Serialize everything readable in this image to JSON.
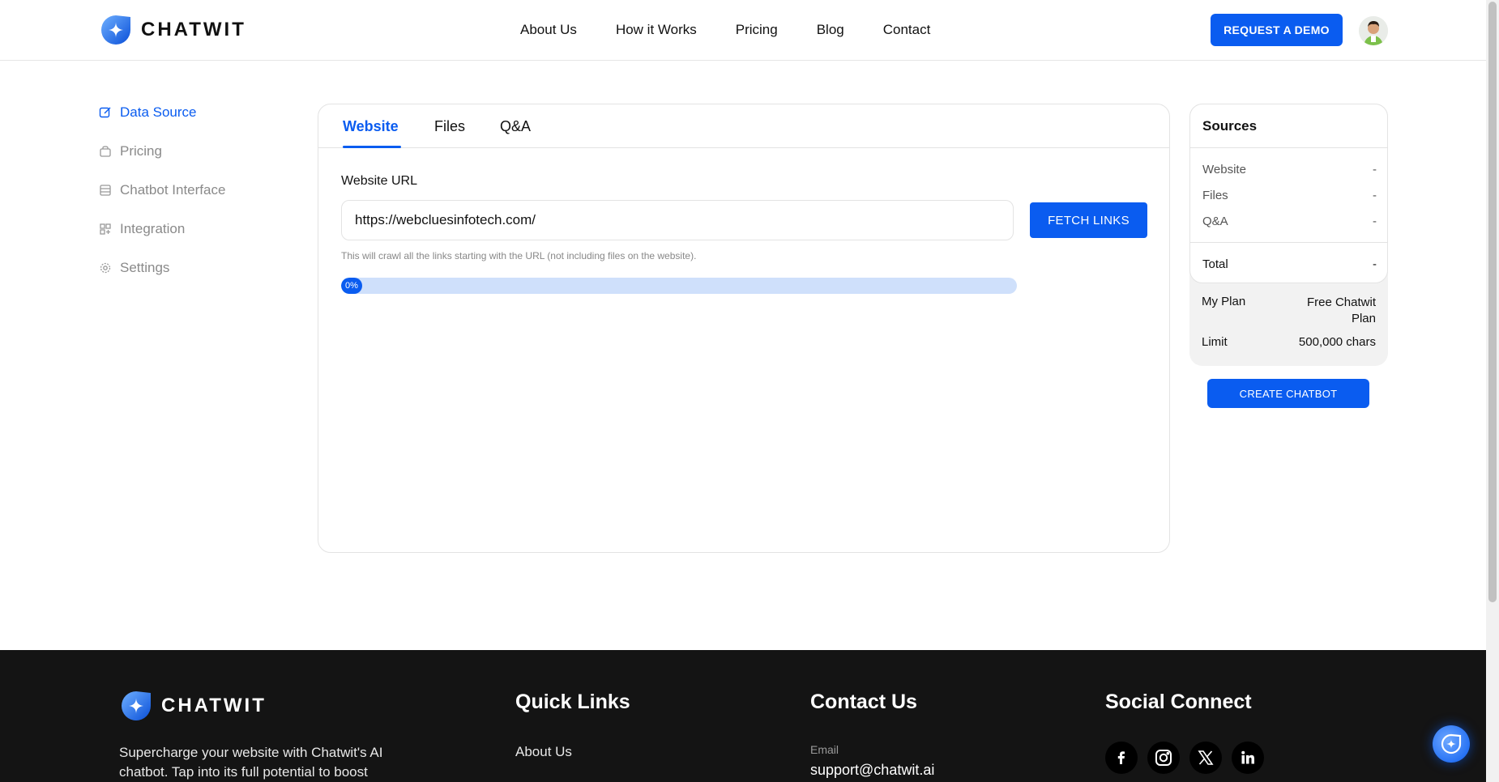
{
  "header": {
    "logo_text": "CHATWIT",
    "nav": [
      "About Us",
      "How it Works",
      "Pricing",
      "Blog",
      "Contact"
    ],
    "demo_button": "REQUEST A DEMO"
  },
  "sidebar": {
    "items": [
      {
        "label": "Data Source",
        "icon": "edit-icon",
        "active": true
      },
      {
        "label": "Pricing",
        "icon": "bag-icon",
        "active": false
      },
      {
        "label": "Chatbot Interface",
        "icon": "window-icon",
        "active": false
      },
      {
        "label": "Integration",
        "icon": "grid-icon",
        "active": false
      },
      {
        "label": "Settings",
        "icon": "gear-icon",
        "active": false
      }
    ]
  },
  "main": {
    "tabs": [
      "Website",
      "Files",
      "Q&A"
    ],
    "active_tab": "Website",
    "url_label": "Website URL",
    "url_value": "https://webcluesinfotech.com/",
    "fetch_button": "FETCH LINKS",
    "hint": "This will crawl all the links starting with the URL (not including files on the website).",
    "progress": {
      "value": 0,
      "label": "0%"
    }
  },
  "sources": {
    "title": "Sources",
    "rows": [
      {
        "label": "Website",
        "value": "-"
      },
      {
        "label": "Files",
        "value": "-"
      },
      {
        "label": "Q&A",
        "value": "-"
      }
    ],
    "total_label": "Total",
    "total_value": "-",
    "plan_label": "My Plan",
    "plan_value": "Free Chatwit Plan",
    "limit_label": "Limit",
    "limit_value": "500,000 chars",
    "create_button": "CREATE CHATBOT"
  },
  "footer": {
    "logo_text": "CHATWIT",
    "description": "Supercharge your website with Chatwit's AI chatbot. Tap into its full potential to boost",
    "quick_links_heading": "Quick Links",
    "quick_links": [
      "About Us"
    ],
    "contact_heading": "Contact Us",
    "email_label": "Email",
    "email": "support@chatwit.ai",
    "social_heading": "Social Connect",
    "socials": [
      "facebook-icon",
      "instagram-icon",
      "x-icon",
      "linkedin-icon"
    ]
  },
  "colors": {
    "accent": "#0a5cf0",
    "progress_track": "#cfe0fb",
    "footer_bg": "#141414",
    "sources_bg": "#f2f2f2"
  }
}
